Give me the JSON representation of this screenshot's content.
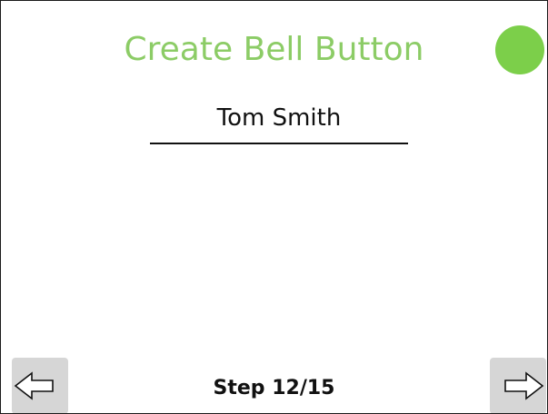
{
  "header": {
    "title": "Create Bell Button",
    "title_color": "#8ccc66"
  },
  "status_indicator": {
    "icon": "status-dot",
    "color": "#7ccf4a"
  },
  "name_field": {
    "value": "Tom Smith"
  },
  "footer": {
    "step_label": "Step 12/15",
    "back_icon": "left-arrow-icon",
    "next_icon": "right-arrow-icon"
  }
}
